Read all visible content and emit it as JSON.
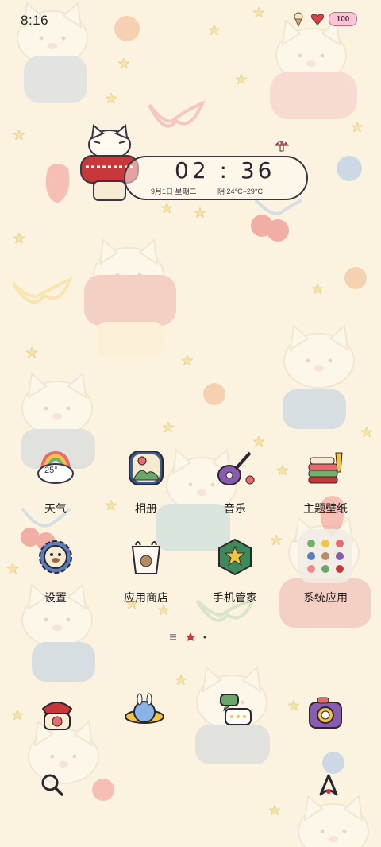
{
  "status_bar": {
    "time": "8:16",
    "battery": "100",
    "icons": [
      "ice-cream-icon",
      "heart-flower-icon"
    ]
  },
  "clock_widget": {
    "time": "02 : 36",
    "date": "9月1日 星期二",
    "weather": "阴 24°C~29°C"
  },
  "apps_row1": [
    {
      "label": "天气",
      "icon": "weather-icon",
      "temp": "25°"
    },
    {
      "label": "相册",
      "icon": "gallery-icon"
    },
    {
      "label": "音乐",
      "icon": "guitar-icon"
    },
    {
      "label": "主题壁纸",
      "icon": "theme-icon"
    }
  ],
  "apps_row2": [
    {
      "label": "设置",
      "icon": "settings-gear-icon"
    },
    {
      "label": "应用商店",
      "icon": "app-store-bag-icon"
    },
    {
      "label": "手机管家",
      "icon": "shield-star-icon"
    },
    {
      "label": "系统应用",
      "icon": "folder-icon"
    }
  ],
  "dock": [
    {
      "name": "phone",
      "icon": "phone-icon"
    },
    {
      "name": "browser",
      "icon": "planet-bunny-icon"
    },
    {
      "name": "messages",
      "icon": "message-bubbles-icon"
    },
    {
      "name": "camera",
      "icon": "camera-icon"
    }
  ],
  "colors": {
    "background": "#fbf3df",
    "text": "#1e1b1e",
    "accent_red": "#c8383a"
  }
}
